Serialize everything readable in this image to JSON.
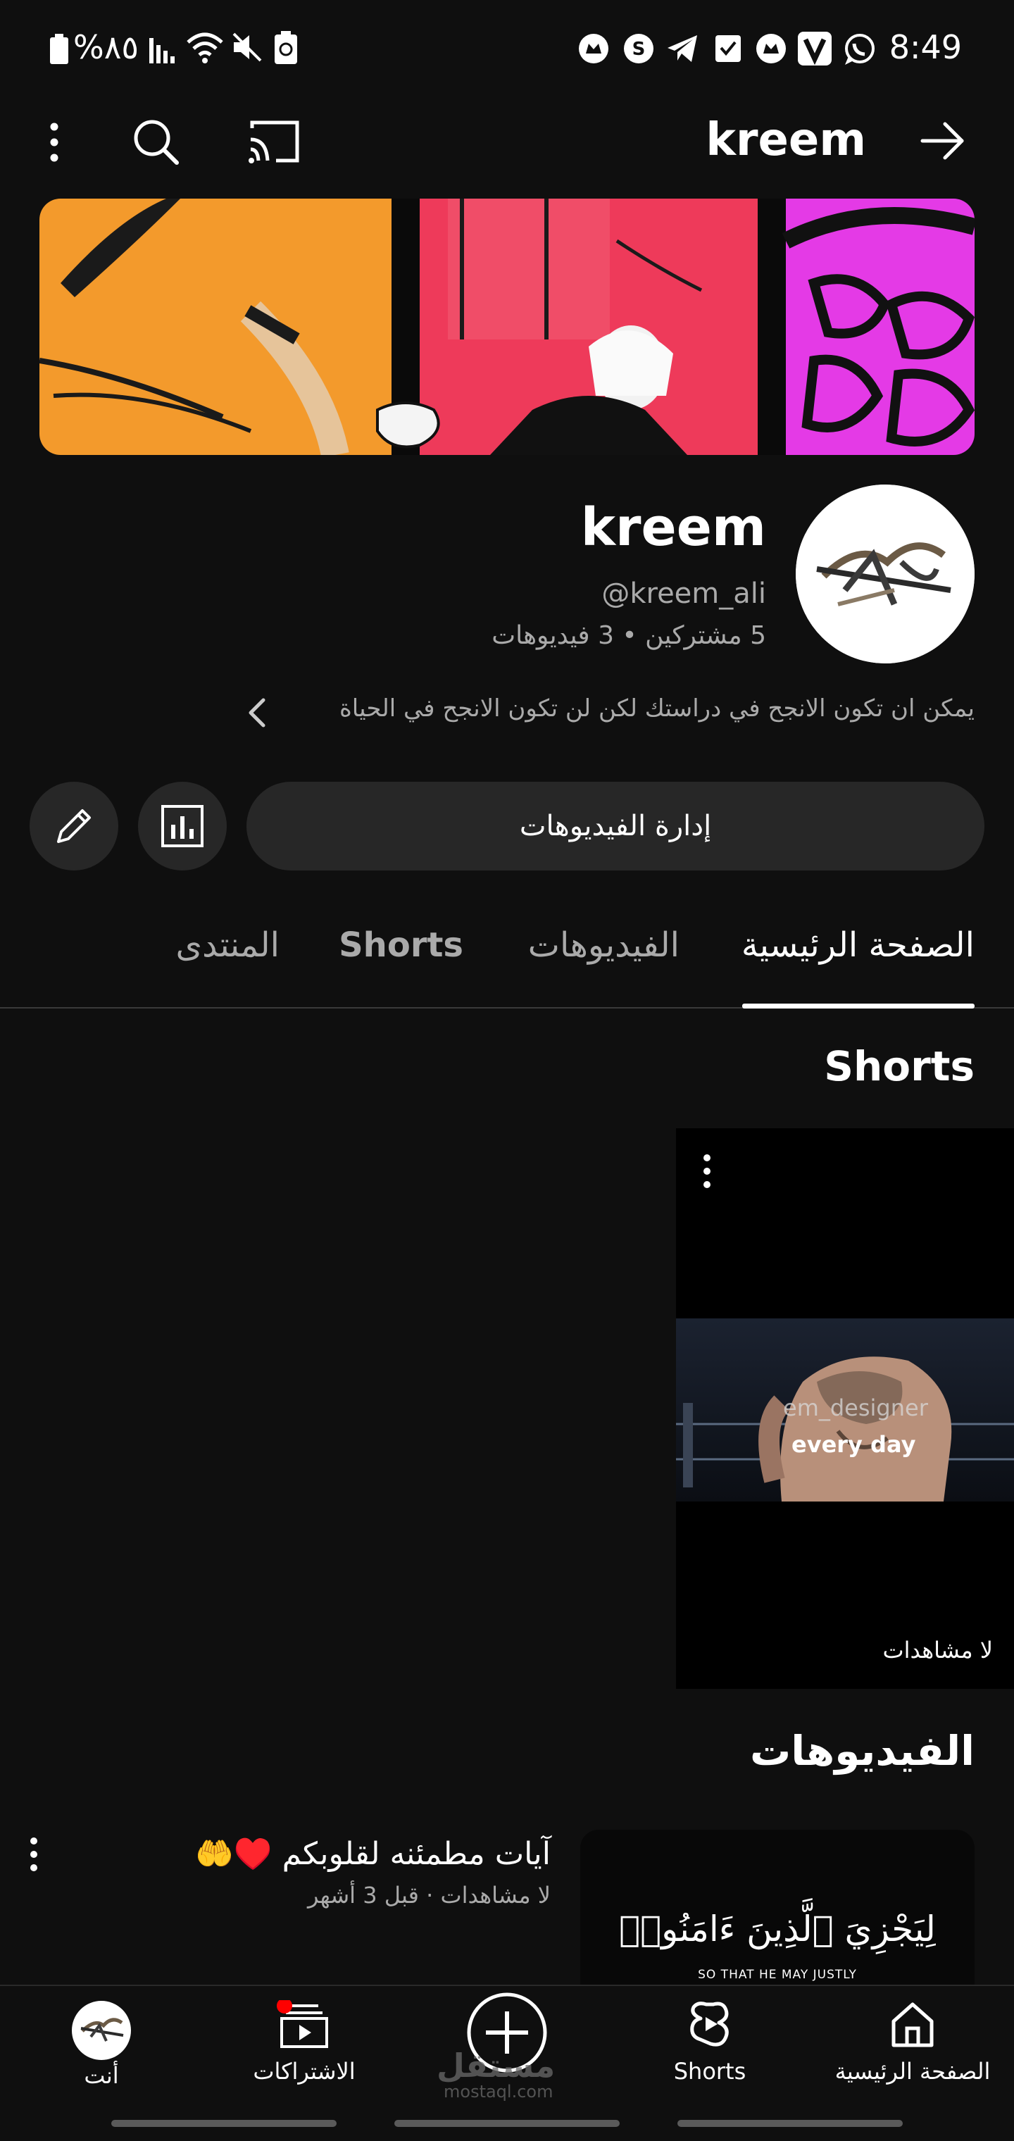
{
  "status_bar": {
    "battery_text": "%٨٥",
    "time": "8:49",
    "left_icons": [
      "battery-icon",
      "signal-icon",
      "wifi-icon",
      "mute-icon",
      "battery-saver-icon"
    ],
    "right_icons": [
      "app-notification-icon",
      "shazam-icon",
      "telegram-icon",
      "checkbox-icon",
      "app-notification-icon",
      "vpn-icon",
      "whatsapp-icon"
    ]
  },
  "top_bar": {
    "title": "kreem",
    "icons": [
      "more-vert-icon",
      "search-icon",
      "cast-icon",
      "arrow-forward-icon"
    ]
  },
  "channel": {
    "name": "kreem",
    "handle": "@kreem_ali",
    "stats": "5 مشتركين • 3 فيديوهات",
    "description": "يمكن ان تكون الانجح في دراستك لكن لن تكون الانجح في الحياة"
  },
  "actions": {
    "manage_videos": "إدارة الفيديوهات",
    "analytics_icon": "analytics-icon",
    "edit_icon": "edit-icon"
  },
  "tabs": [
    {
      "label": "الصفحة الرئيسية",
      "active": true
    },
    {
      "label": "الفيديوهات",
      "active": false
    },
    {
      "label": "Shorts",
      "active": false
    },
    {
      "label": "المنتدى",
      "active": false
    }
  ],
  "shorts_section": {
    "title": "Shorts",
    "items": [
      {
        "overlay_text": "every day",
        "watermark": "em_designer",
        "views": "لا مشاهدات"
      }
    ]
  },
  "videos_section": {
    "title": "الفيديوهات",
    "items": [
      {
        "title": "آيات مطمئنه لقلوبكم ♥️🤲",
        "meta": "لا مشاهدات · قبل 3 أشهر",
        "thumb_arabic": "لِيَجْزِيَ ٱلَّذِينَ ءَامَنُوا۟",
        "thumb_english": "SO THAT HE MAY JUSTLY"
      }
    ]
  },
  "bottom_nav": [
    {
      "label": "الصفحة الرئيسية",
      "icon": "home-icon"
    },
    {
      "label": "Shorts",
      "icon": "shorts-icon"
    },
    {
      "label": "",
      "icon": "create-icon"
    },
    {
      "label": "الاشتراكات",
      "icon": "subscriptions-icon",
      "badge": true
    },
    {
      "label": "أنت",
      "icon": "you-avatar-icon"
    }
  ],
  "watermark": {
    "text": "مستقل",
    "sub": "mostaql.com"
  },
  "colors": {
    "background": "#0f0f0f",
    "button_bg": "#272727",
    "secondary_text": "#aaaaaa",
    "badge_red": "#ff0000"
  }
}
